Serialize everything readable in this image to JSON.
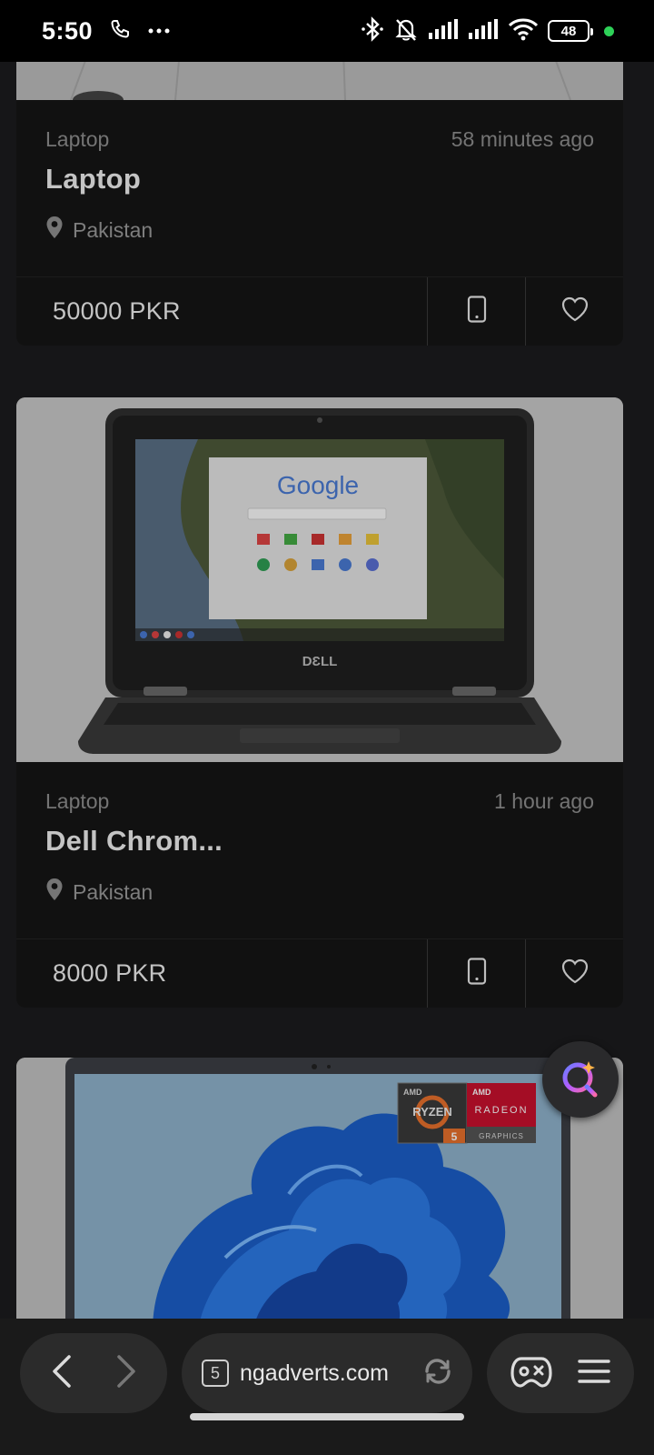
{
  "status_bar": {
    "time": "5:50",
    "battery": "48",
    "icons": [
      "phone-icon",
      "more-icon",
      "bluetooth-icon",
      "bell-muted-icon",
      "signal-icon",
      "signal-icon",
      "wifi-icon",
      "battery-icon",
      "green-dot"
    ]
  },
  "listings": [
    {
      "category": "Laptop",
      "time_ago": "58 minutes ago",
      "title": "Laptop",
      "location": "Pakistan",
      "price": "50000 PKR"
    },
    {
      "category": "Laptop",
      "time_ago": "1 hour ago",
      "title": "Dell Chrom...",
      "location": "Pakistan",
      "price": "8000 PKR",
      "image": {
        "brand": "DƐLL",
        "screen_logo": "Google"
      }
    },
    {
      "image": {
        "ryzen_label": "RYZEN",
        "ryzen_series": "5",
        "radeon_label": "RADEON",
        "radeon_sub": "GRAPHICS",
        "amd": "AMD"
      }
    }
  ],
  "browser": {
    "tab_count": "5",
    "url": "ngadverts.com"
  },
  "colors": {
    "page_bg": "#1c1c1e",
    "card_bg": "#151515",
    "accent_dot": "#2ed158"
  }
}
